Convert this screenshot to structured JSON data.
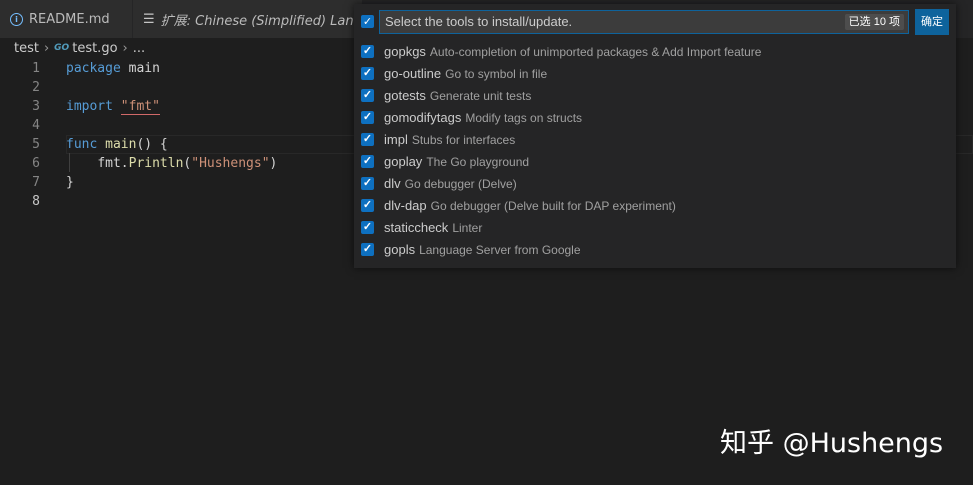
{
  "tabs": [
    {
      "label": "README.md",
      "icon": "info-icon"
    },
    {
      "label": "扩展: Chinese (Simplified) Language",
      "icon": "extension-icon"
    }
  ],
  "breadcrumb": {
    "folder": "test",
    "file": "test.go",
    "ellipsis": "..."
  },
  "editor": {
    "line_numbers": [
      "1",
      "2",
      "3",
      "4",
      "5",
      "6",
      "7",
      "8"
    ],
    "code": {
      "l1_kw": "package",
      "l1_rest": " main",
      "l3_kw": "import",
      "l3_str": "\"fmt\"",
      "l5_kw": "func",
      "l5_fn": "main",
      "l5_rest": "() {",
      "l6_obj": "fmt.",
      "l6_fn": "Println",
      "l6_paren_open": "(",
      "l6_str": "\"Hushengs\"",
      "l6_paren_close": ")",
      "l7": "}"
    }
  },
  "quickpick": {
    "placeholder": "Select the tools to install/update.",
    "count_badge": "已选 10 项",
    "ok_label": "确定",
    "items": [
      {
        "label": "gopkgs",
        "description": "Auto-completion of unimported packages & Add Import feature",
        "checked": true
      },
      {
        "label": "go-outline",
        "description": "Go to symbol in file",
        "checked": true
      },
      {
        "label": "gotests",
        "description": "Generate unit tests",
        "checked": true
      },
      {
        "label": "gomodifytags",
        "description": "Modify tags on structs",
        "checked": true
      },
      {
        "label": "impl",
        "description": "Stubs for interfaces",
        "checked": true
      },
      {
        "label": "goplay",
        "description": "The Go playground",
        "checked": true
      },
      {
        "label": "dlv",
        "description": "Go debugger (Delve)",
        "checked": true
      },
      {
        "label": "dlv-dap",
        "description": "Go debugger (Delve built for DAP experiment)",
        "checked": true
      },
      {
        "label": "staticcheck",
        "description": "Linter",
        "checked": true
      },
      {
        "label": "gopls",
        "description": "Language Server from Google",
        "checked": true
      }
    ]
  },
  "watermark": "知乎 @Hushengs",
  "colors": {
    "accent": "#0e639c",
    "checkbox": "#0e70c0",
    "background": "#1e1e1e"
  }
}
